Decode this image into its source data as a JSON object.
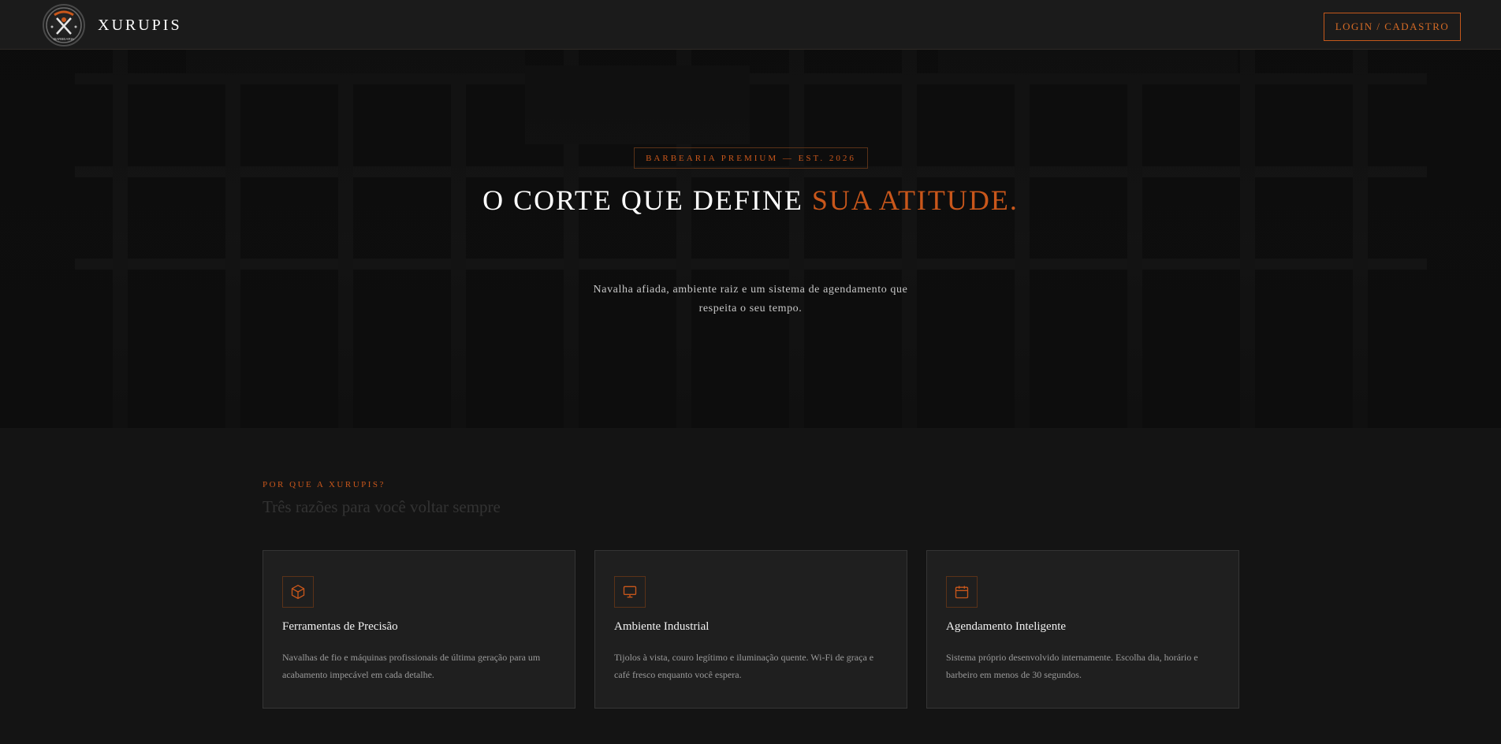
{
  "header": {
    "brand_name": "XURUPIS",
    "logo_icon": "barber-crest-logo",
    "logo_text": "BARBEARIA",
    "login_label": "LOGIN / CADASTRO"
  },
  "hero": {
    "badge": "BARBEARIA PREMIUM — EST. 2026",
    "title_main": "O CORTE QUE DEFINE ",
    "title_accent": "SUA ATITUDE.",
    "subtitle": "Navalha afiada, ambiente raiz e um sistema de agendamento que respeita o seu tempo."
  },
  "features": {
    "eyebrow": "POR QUE A XURUPIS?",
    "title": "Três razões para você voltar sempre",
    "cards": [
      {
        "icon": "cube-icon",
        "title": "Ferramentas de Precisão",
        "text": "Navalhas de fio e máquinas profissionais de última geração para um acabamento impecável em cada detalhe."
      },
      {
        "icon": "monitor-icon",
        "title": "Ambiente Industrial",
        "text": "Tijolos à vista, couro legítimo e iluminação quente. Wi-Fi de graça e café fresco enquanto você espera."
      },
      {
        "icon": "calendar-icon",
        "title": "Agendamento Inteligente",
        "text": "Sistema próprio desenvolvido internamente. Escolha dia, horário e barbeiro em menos de 30 segundos."
      }
    ]
  },
  "colors": {
    "accent": "#c9571b",
    "background": "#121212",
    "card": "#1f1f1f"
  }
}
